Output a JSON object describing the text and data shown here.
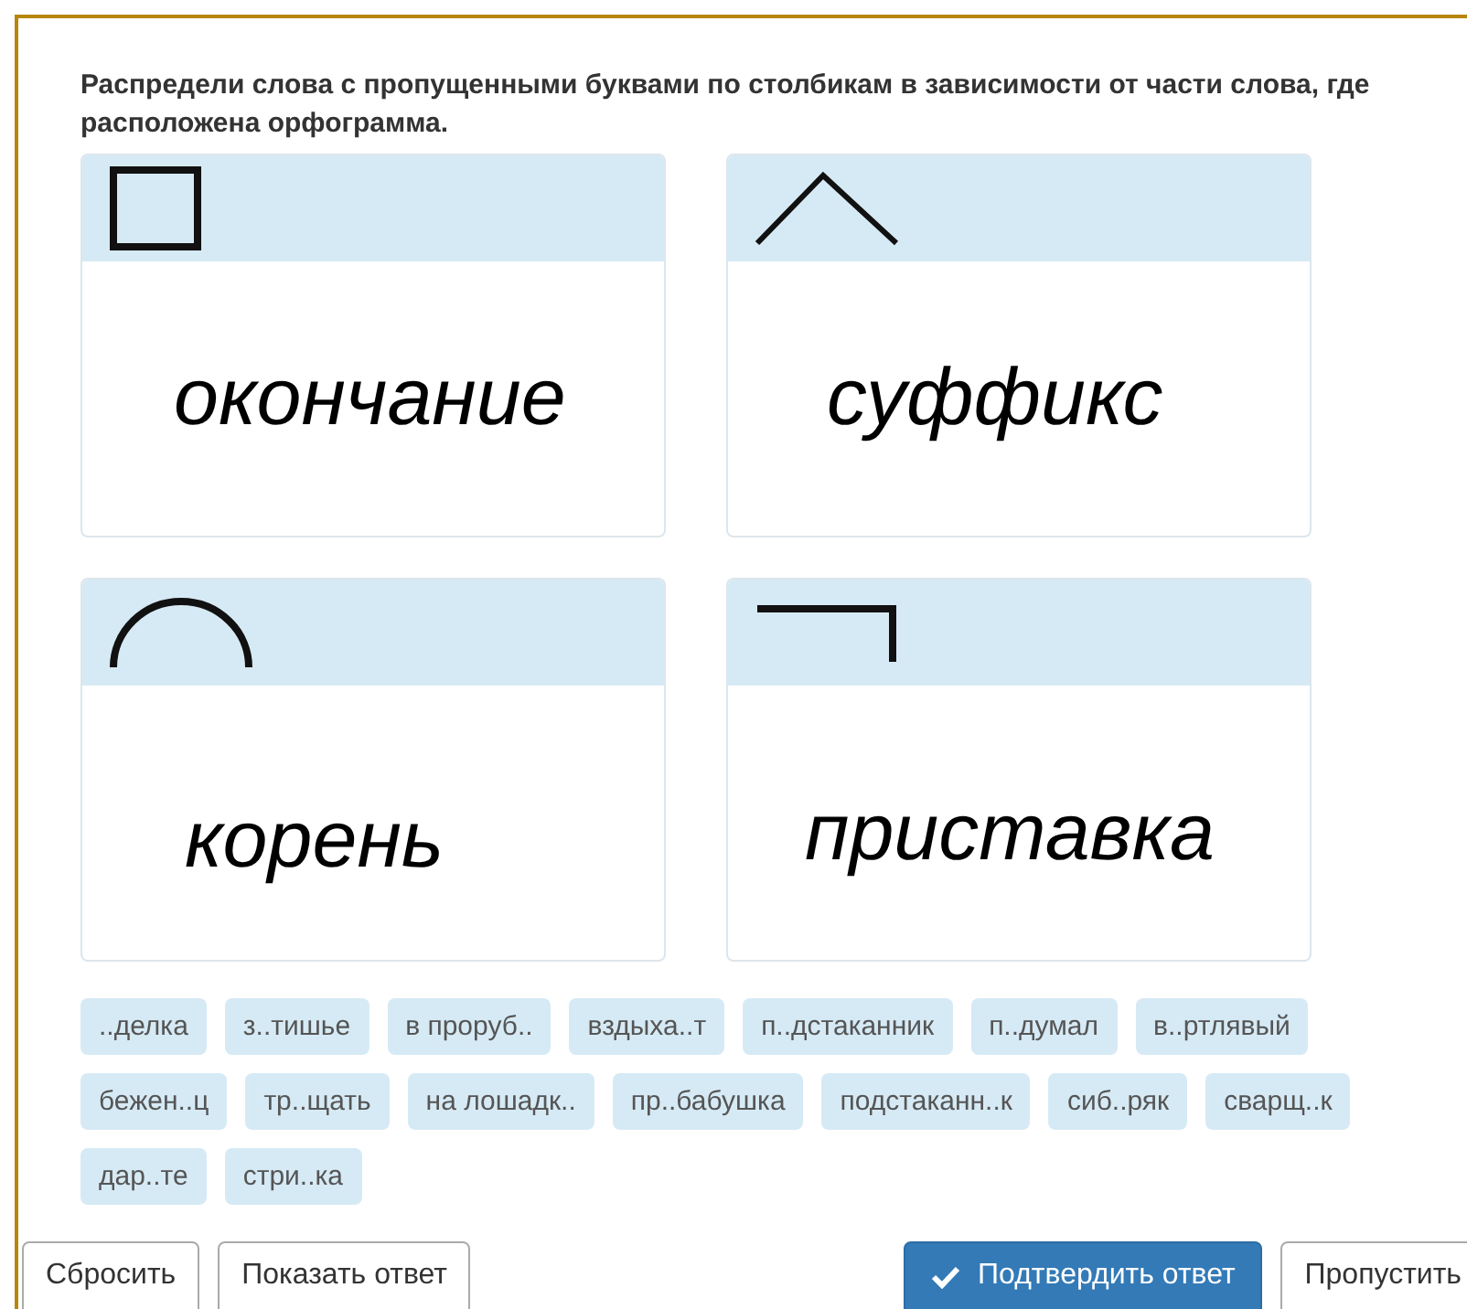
{
  "instruction": "Распредели слова с пропущенными буквами по столбикам в зависимости от части слова, где расположена орфограмма.",
  "columns": [
    {
      "kind": "ending",
      "label": "окончание"
    },
    {
      "kind": "suffix",
      "label": "суффикс"
    },
    {
      "kind": "root",
      "label": "корень"
    },
    {
      "kind": "prefix",
      "label": "приставка"
    }
  ],
  "words": [
    "..делка",
    "з..тишье",
    "в проруб..",
    "вздыха..т",
    "п..дстаканник",
    "п..думал",
    "в..ртлявый",
    "бежен..ц",
    "тр..щать",
    "на лошадк..",
    "пр..бабушка",
    "подстаканн..к",
    "сиб..ряк",
    "сварщ..к",
    "дар..те",
    "стри..ка"
  ],
  "buttons": [
    {
      "kind": "default",
      "label": "Сбросить"
    },
    {
      "kind": "default",
      "label": "Показать ответ"
    },
    {
      "kind": "primary",
      "label": "Подтвердить ответ"
    },
    {
      "kind": "default",
      "label": "Пропустить"
    }
  ]
}
